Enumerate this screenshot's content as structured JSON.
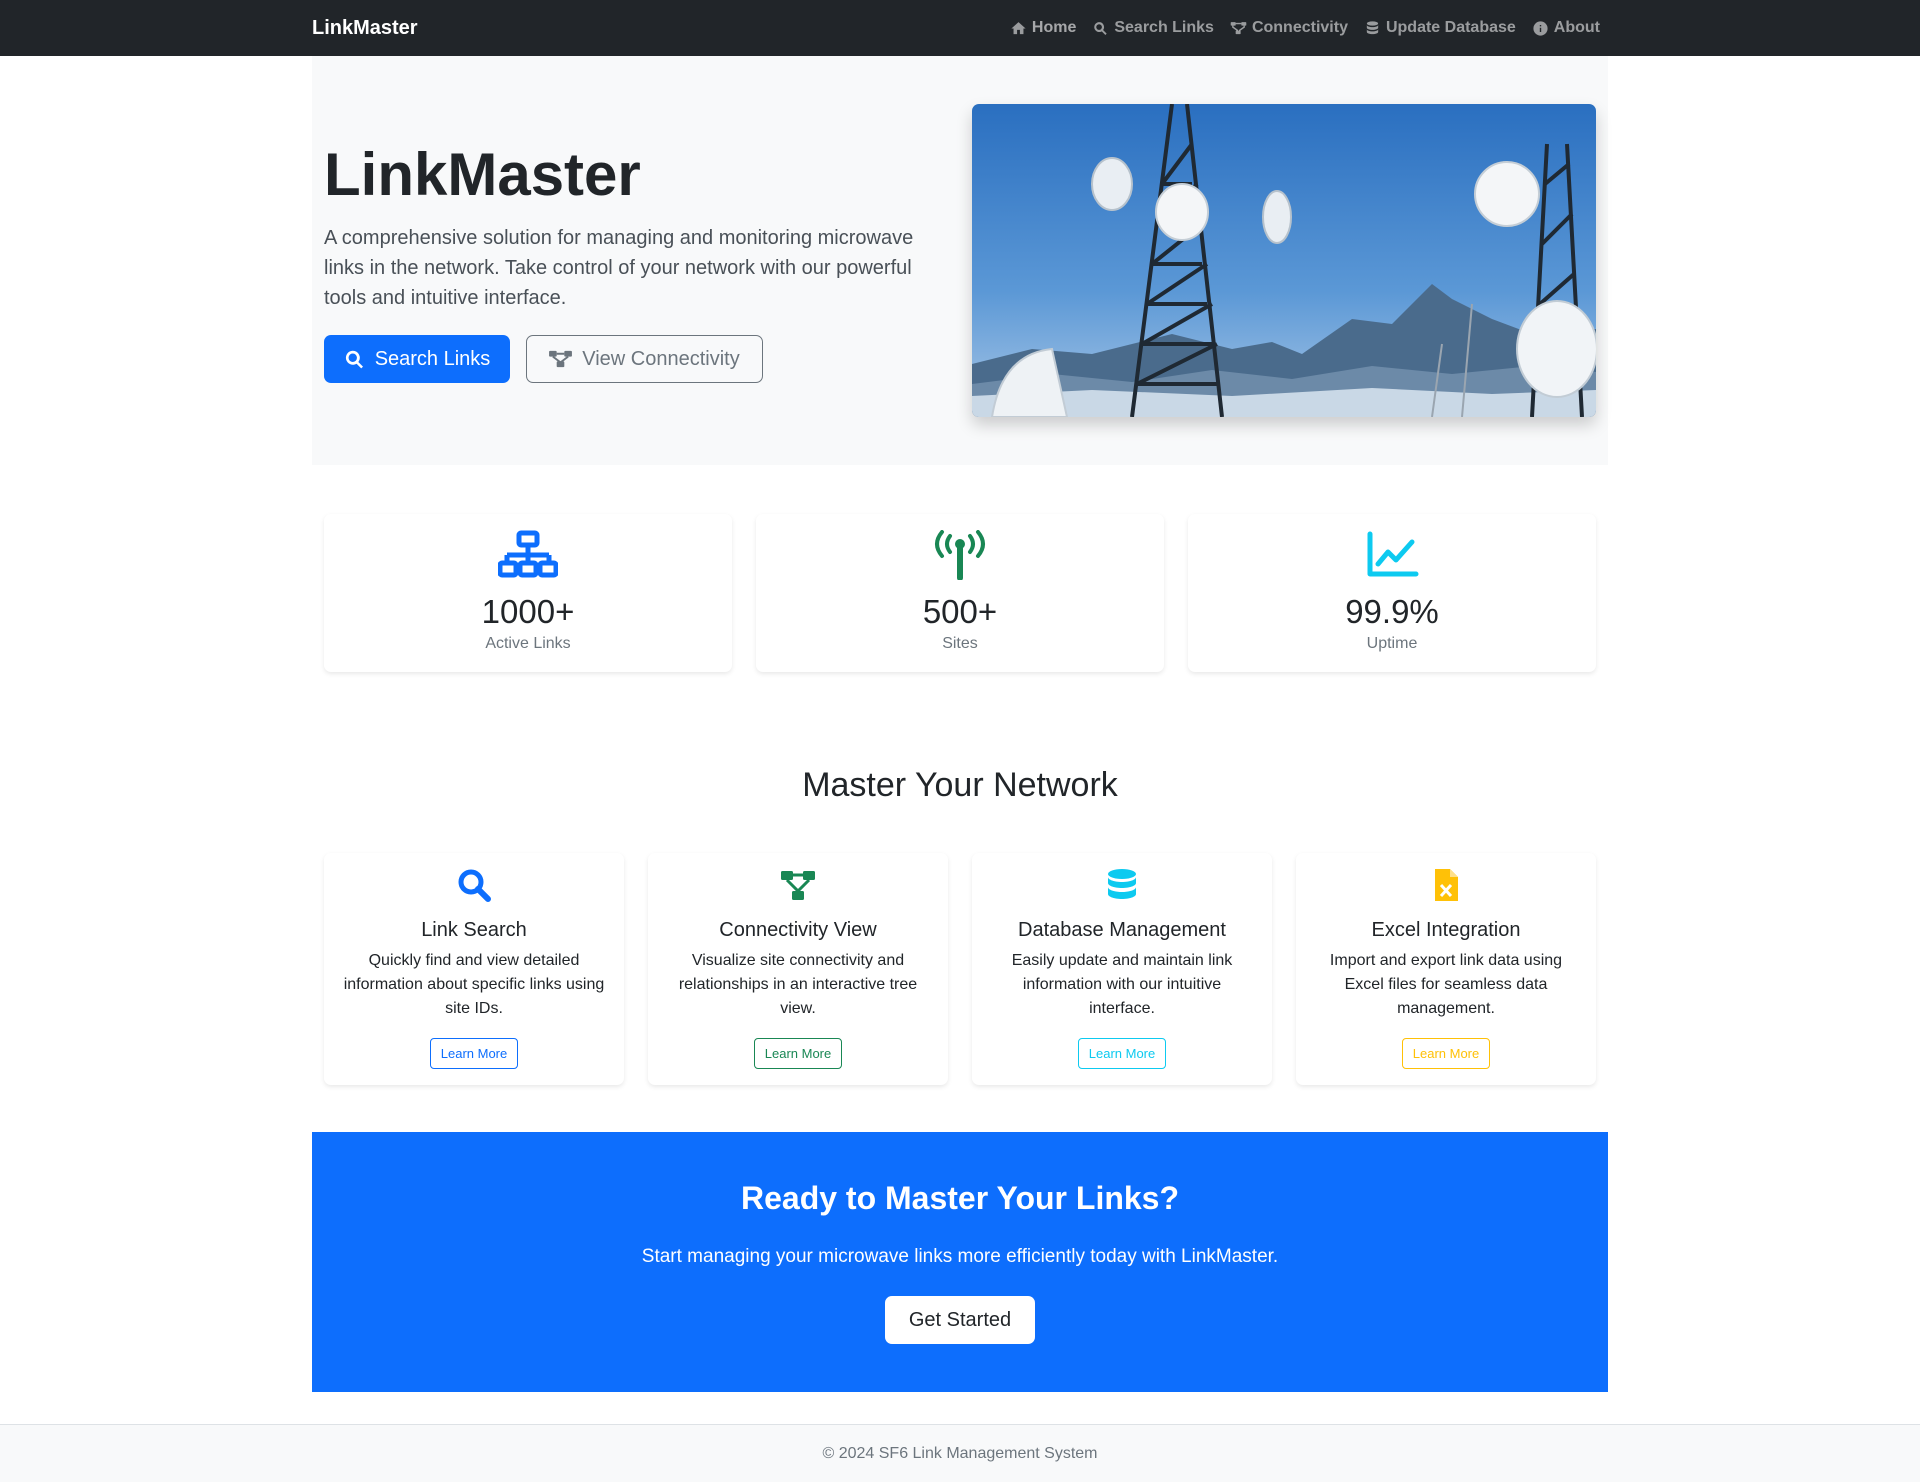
{
  "navbar": {
    "brand": "LinkMaster",
    "items": [
      {
        "label": "Home",
        "icon": "home-icon"
      },
      {
        "label": "Search Links",
        "icon": "search-icon"
      },
      {
        "label": "Connectivity",
        "icon": "diagram-icon"
      },
      {
        "label": "Update Database",
        "icon": "database-icon"
      },
      {
        "label": "About",
        "icon": "info-icon"
      }
    ]
  },
  "hero": {
    "title": "LinkMaster",
    "lead": "A comprehensive solution for managing and monitoring microwave links in the network. Take control of your network with our powerful tools and intuitive interface.",
    "primary_button": "Search Links",
    "secondary_button": "View Connectivity",
    "image_alt": "microwave tower image"
  },
  "stats": [
    {
      "value": "1000+",
      "label": "Active Links",
      "icon": "network-icon",
      "color": "#0d6efd"
    },
    {
      "value": "500+",
      "label": "Sites",
      "icon": "broadcast-tower-icon",
      "color": "#198754"
    },
    {
      "value": "99.9%",
      "label": "Uptime",
      "icon": "line-chart-icon",
      "color": "#0dcaf0"
    }
  ],
  "features": {
    "title": "Master Your Network",
    "cards": [
      {
        "title": "Link Search",
        "text": "Quickly find and view detailed information about specific links using site IDs.",
        "button": "Learn More",
        "icon": "search-icon",
        "color": "#0d6efd"
      },
      {
        "title": "Connectivity View",
        "text": "Visualize site connectivity and relationships in an interactive tree view.",
        "button": "Learn More",
        "icon": "diagram-icon",
        "color": "#198754"
      },
      {
        "title": "Database Management",
        "text": "Easily update and maintain link information with our intuitive interface.",
        "button": "Learn More",
        "icon": "database-icon",
        "color": "#0dcaf0"
      },
      {
        "title": "Excel Integration",
        "text": "Import and export link data using Excel files for seamless data management.",
        "button": "Learn More",
        "icon": "excel-file-icon",
        "color": "#ffc107"
      }
    ]
  },
  "cta": {
    "title": "Ready to Master Your Links?",
    "lead": "Start managing your microwave links more efficiently today with LinkMaster.",
    "button": "Get Started"
  },
  "footer": {
    "text": "© 2024 SF6 Link Management System"
  }
}
